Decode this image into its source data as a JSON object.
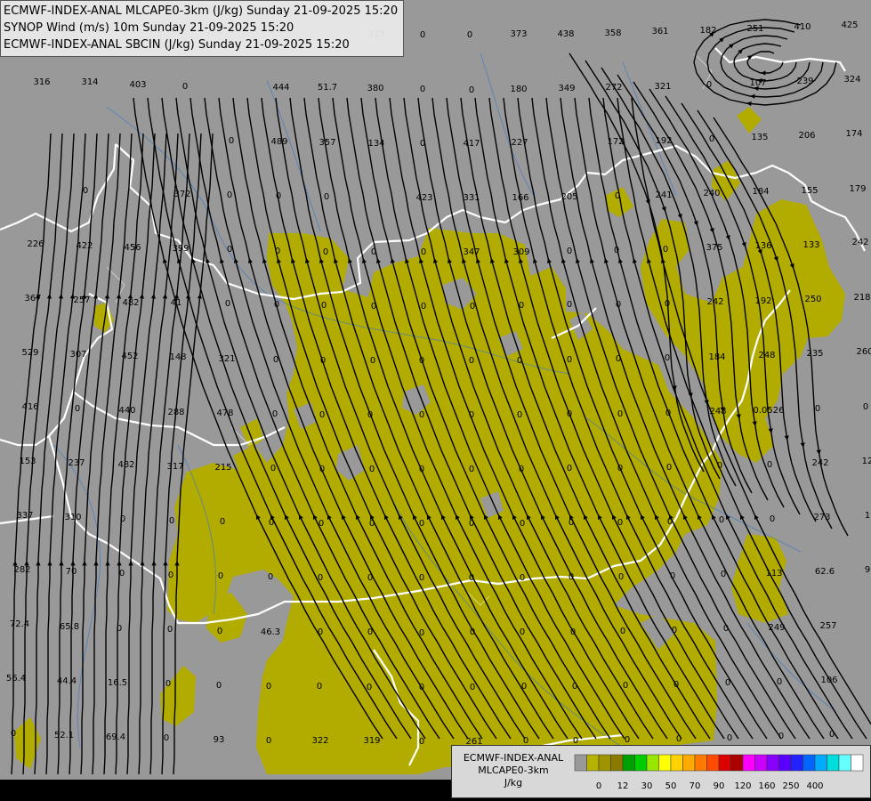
{
  "layers": [
    "ECMWF-INDEX-ANAL MLCAPE0-3km (J/kg) Sunday 21-09-2025 15:20",
    "SYNOP Wind (m/s) 10m Sunday 21-09-2025 15:20",
    "ECMWF-INDEX-ANAL SBCIN (J/kg) Sunday 21-09-2025 15:20"
  ],
  "legend": {
    "title_line1": "ECMWF-INDEX-ANAL",
    "title_line2": "MLCAPE0-3km",
    "unit": "J/kg",
    "colors": [
      "#999999",
      "#b5b300",
      "#9e9400",
      "#8a7a00",
      "#00a000",
      "#00cc00",
      "#99e600",
      "#ffff00",
      "#ffd200",
      "#ffaa00",
      "#ff7a00",
      "#ff4a00",
      "#dd0000",
      "#aa0000",
      "#ff00ff",
      "#cc00ff",
      "#8a00ff",
      "#5a00ff",
      "#2222ff",
      "#0066ff",
      "#00aaff",
      "#00dddd",
      "#66ffff",
      "#ffffff"
    ],
    "ticks": [
      "0",
      "12",
      "30",
      "50",
      "70",
      "90",
      "120",
      "160",
      "250",
      "400"
    ],
    "tick_at": [
      1,
      3,
      5,
      7,
      9,
      11,
      13,
      15,
      17,
      19
    ]
  },
  "colors": {
    "background": "#999999",
    "cape_fill": "#b2ac00",
    "border": "#ffffff",
    "streamline": "#000000"
  },
  "sbcin_labels": [
    [
      "316",
      47,
      91
    ],
    [
      "314",
      101,
      91
    ],
    [
      "403",
      155,
      94
    ],
    [
      "0",
      208,
      96
    ],
    [
      "444",
      316,
      97
    ],
    [
      "51.7",
      368,
      97
    ],
    [
      "380",
      422,
      98
    ],
    [
      "0",
      475,
      99
    ],
    [
      "0",
      530,
      100
    ],
    [
      "180",
      583,
      99
    ],
    [
      "349",
      637,
      98
    ],
    [
      "272",
      690,
      97
    ],
    [
      "321",
      745,
      96
    ],
    [
      "0",
      797,
      94
    ],
    [
      "107",
      852,
      92
    ],
    [
      "239",
      905,
      90
    ],
    [
      "324",
      958,
      88
    ],
    [
      "323",
      423,
      37
    ],
    [
      "0",
      475,
      38
    ],
    [
      "0",
      528,
      38
    ],
    [
      "373",
      583,
      37
    ],
    [
      "438",
      636,
      37
    ],
    [
      "358",
      689,
      36
    ],
    [
      "361",
      742,
      34
    ],
    [
      "182",
      796,
      33
    ],
    [
      "251",
      849,
      31
    ],
    [
      "410",
      902,
      29
    ],
    [
      "425",
      955,
      27
    ],
    [
      "0",
      260,
      157
    ],
    [
      "489",
      314,
      158
    ],
    [
      "357",
      368,
      159
    ],
    [
      "134",
      423,
      160
    ],
    [
      "0",
      475,
      160
    ],
    [
      "417",
      530,
      160
    ],
    [
      "227",
      584,
      159
    ],
    [
      "172",
      692,
      158
    ],
    [
      "192",
      746,
      157
    ],
    [
      "0",
      800,
      155
    ],
    [
      "135",
      854,
      153
    ],
    [
      "206",
      907,
      151
    ],
    [
      "174",
      960,
      149
    ],
    [
      "0",
      96,
      213
    ],
    [
      "372",
      205,
      217
    ],
    [
      "0",
      258,
      218
    ],
    [
      "0",
      313,
      219
    ],
    [
      "0",
      367,
      220
    ],
    [
      "423",
      477,
      221
    ],
    [
      "331",
      530,
      221
    ],
    [
      "166",
      585,
      221
    ],
    [
      "205",
      640,
      220
    ],
    [
      "0",
      694,
      219
    ],
    [
      "241",
      746,
      218
    ],
    [
      "240",
      800,
      216
    ],
    [
      "184",
      855,
      214
    ],
    [
      "155",
      910,
      213
    ],
    [
      "179",
      964,
      211
    ],
    [
      "226",
      40,
      273
    ],
    [
      "422",
      95,
      275
    ],
    [
      "456",
      149,
      277
    ],
    [
      "399",
      203,
      278
    ],
    [
      "0",
      258,
      279
    ],
    [
      "0",
      312,
      281
    ],
    [
      "0",
      366,
      282
    ],
    [
      "0",
      420,
      282
    ],
    [
      "0",
      476,
      282
    ],
    [
      "347",
      530,
      282
    ],
    [
      "309",
      586,
      282
    ],
    [
      "0",
      640,
      281
    ],
    [
      "0",
      693,
      280
    ],
    [
      "0",
      748,
      279
    ],
    [
      "375",
      803,
      277
    ],
    [
      "136",
      858,
      275
    ],
    [
      "133",
      912,
      274
    ],
    [
      "242",
      967,
      271
    ],
    [
      "367",
      37,
      334
    ],
    [
      "257",
      92,
      336
    ],
    [
      "482",
      147,
      339
    ],
    [
      "41",
      198,
      339
    ],
    [
      "0",
      256,
      340
    ],
    [
      "0",
      311,
      341
    ],
    [
      "0",
      364,
      342
    ],
    [
      "0",
      420,
      343
    ],
    [
      "0",
      476,
      343
    ],
    [
      "0",
      531,
      343
    ],
    [
      "0",
      586,
      342
    ],
    [
      "0",
      640,
      341
    ],
    [
      "0",
      695,
      341
    ],
    [
      "0",
      750,
      340
    ],
    [
      "242",
      804,
      338
    ],
    [
      "192",
      858,
      337
    ],
    [
      "250",
      914,
      335
    ],
    [
      "218",
      969,
      333
    ],
    [
      "529",
      34,
      395
    ],
    [
      "307",
      88,
      397
    ],
    [
      "452",
      146,
      399
    ],
    [
      "148",
      200,
      400
    ],
    [
      "321",
      255,
      402
    ],
    [
      "0",
      310,
      403
    ],
    [
      "0",
      363,
      404
    ],
    [
      "0",
      419,
      404
    ],
    [
      "0",
      474,
      404
    ],
    [
      "0",
      530,
      404
    ],
    [
      "0",
      584,
      404
    ],
    [
      "0",
      640,
      403
    ],
    [
      "0",
      695,
      402
    ],
    [
      "0",
      750,
      401
    ],
    [
      "184",
      806,
      400
    ],
    [
      "248",
      862,
      398
    ],
    [
      "235",
      916,
      396
    ],
    [
      "260",
      972,
      394
    ],
    [
      "416",
      34,
      456
    ],
    [
      "0",
      87,
      458
    ],
    [
      "440",
      143,
      460
    ],
    [
      "288",
      198,
      462
    ],
    [
      "478",
      253,
      463
    ],
    [
      "0",
      309,
      464
    ],
    [
      "0",
      362,
      465
    ],
    [
      "0",
      416,
      465
    ],
    [
      "0",
      474,
      465
    ],
    [
      "0",
      530,
      465
    ],
    [
      "0",
      584,
      465
    ],
    [
      "0",
      640,
      464
    ],
    [
      "0",
      697,
      464
    ],
    [
      "0",
      751,
      463
    ],
    [
      "248",
      807,
      461
    ],
    [
      "0.0526",
      864,
      460
    ],
    [
      "0",
      919,
      458
    ],
    [
      "0",
      973,
      456
    ],
    [
      "153",
      31,
      517
    ],
    [
      "237",
      86,
      519
    ],
    [
      "482",
      142,
      521
    ],
    [
      "317",
      197,
      523
    ],
    [
      "215",
      251,
      524
    ],
    [
      "0",
      307,
      525
    ],
    [
      "0",
      362,
      526
    ],
    [
      "0",
      418,
      526
    ],
    [
      "0",
      474,
      526
    ],
    [
      "0",
      530,
      526
    ],
    [
      "0",
      586,
      526
    ],
    [
      "0",
      640,
      525
    ],
    [
      "0",
      697,
      525
    ],
    [
      "0",
      752,
      524
    ],
    [
      "0",
      809,
      522
    ],
    [
      "0",
      865,
      521
    ],
    [
      "242",
      922,
      519
    ],
    [
      "12",
      975,
      517
    ],
    [
      "337",
      28,
      578
    ],
    [
      "310",
      82,
      580
    ],
    [
      "0",
      138,
      582
    ],
    [
      "0",
      193,
      584
    ],
    [
      "0",
      250,
      585
    ],
    [
      "0",
      305,
      586
    ],
    [
      "0",
      361,
      587
    ],
    [
      "0",
      418,
      587
    ],
    [
      "0",
      474,
      587
    ],
    [
      "0",
      530,
      587
    ],
    [
      "0",
      587,
      587
    ],
    [
      "0",
      642,
      586
    ],
    [
      "0",
      697,
      586
    ],
    [
      "0",
      753,
      585
    ],
    [
      "0",
      811,
      583
    ],
    [
      "0",
      868,
      582
    ],
    [
      "273",
      924,
      580
    ],
    [
      "1",
      975,
      578
    ],
    [
      "282",
      25,
      639
    ],
    [
      "70",
      80,
      641
    ],
    [
      "0",
      137,
      643
    ],
    [
      "0",
      192,
      645
    ],
    [
      "0",
      248,
      646
    ],
    [
      "0",
      304,
      647
    ],
    [
      "0",
      360,
      648
    ],
    [
      "0",
      416,
      648
    ],
    [
      "0",
      474,
      648
    ],
    [
      "0",
      530,
      648
    ],
    [
      "0",
      587,
      648
    ],
    [
      "0",
      642,
      647
    ],
    [
      "0",
      698,
      647
    ],
    [
      "0",
      756,
      646
    ],
    [
      "0",
      813,
      644
    ],
    [
      "113",
      870,
      643
    ],
    [
      "62.6",
      927,
      641
    ],
    [
      "9",
      975,
      639
    ],
    [
      "72.4",
      22,
      700
    ],
    [
      "65.8",
      78,
      703
    ],
    [
      "0",
      134,
      705
    ],
    [
      "0",
      191,
      706
    ],
    [
      "0",
      247,
      708
    ],
    [
      "46.3",
      304,
      709
    ],
    [
      "0",
      360,
      709
    ],
    [
      "0",
      416,
      709
    ],
    [
      "0",
      474,
      710
    ],
    [
      "0",
      531,
      709
    ],
    [
      "0",
      587,
      709
    ],
    [
      "0",
      644,
      709
    ],
    [
      "0",
      700,
      708
    ],
    [
      "0",
      758,
      707
    ],
    [
      "0",
      816,
      705
    ],
    [
      "249",
      873,
      704
    ],
    [
      "257",
      931,
      702
    ],
    [
      "56.4",
      18,
      761
    ],
    [
      "44.4",
      75,
      764
    ],
    [
      "16.5",
      132,
      766
    ],
    [
      "0",
      189,
      767
    ],
    [
      "0",
      246,
      769
    ],
    [
      "0",
      302,
      770
    ],
    [
      "0",
      359,
      770
    ],
    [
      "0",
      415,
      771
    ],
    [
      "0",
      474,
      771
    ],
    [
      "0",
      531,
      771
    ],
    [
      "0",
      589,
      770
    ],
    [
      "0",
      646,
      770
    ],
    [
      "0",
      703,
      769
    ],
    [
      "0",
      760,
      768
    ],
    [
      "0",
      818,
      766
    ],
    [
      "0",
      876,
      765
    ],
    [
      "106",
      932,
      763
    ],
    [
      "0",
      15,
      823
    ],
    [
      "52.1",
      72,
      825
    ],
    [
      "69.4",
      130,
      827
    ],
    [
      "0",
      187,
      828
    ],
    [
      "93",
      246,
      830
    ],
    [
      "0",
      302,
      831
    ],
    [
      "322",
      360,
      831
    ],
    [
      "319",
      418,
      831
    ],
    [
      "0",
      474,
      832
    ],
    [
      "261",
      533,
      832
    ],
    [
      "0",
      591,
      831
    ],
    [
      "0",
      647,
      831
    ],
    [
      "0",
      705,
      830
    ],
    [
      "0",
      763,
      829
    ],
    [
      "0",
      820,
      828
    ],
    [
      "0",
      878,
      826
    ],
    [
      "0",
      935,
      824
    ]
  ]
}
